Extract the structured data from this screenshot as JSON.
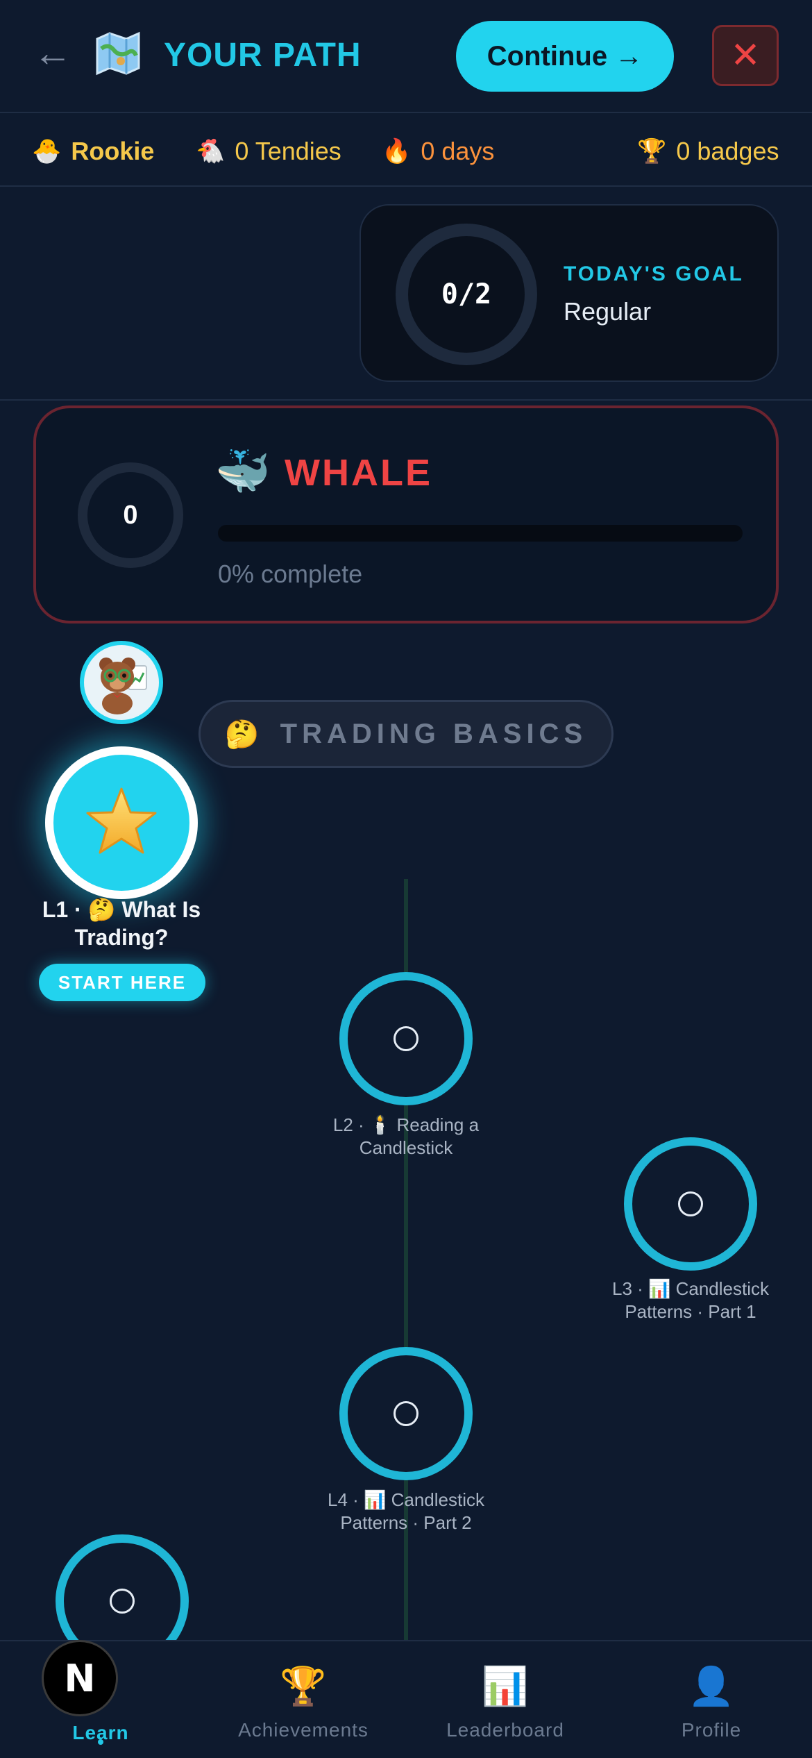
{
  "header": {
    "back_icon": "←",
    "map_icon": "map-icon",
    "title": "YOUR PATH",
    "continue_label": "Continue →",
    "close_icon": "✕"
  },
  "stats": {
    "rank_icon": "🐣",
    "rank": "Rookie",
    "tendies_icon": "🐔",
    "tendies": "0 Tendies",
    "streak_icon": "🔥",
    "streak": "0 days",
    "badges_icon": "🏆",
    "badges": "0 badges"
  },
  "goal": {
    "count": "0/2",
    "label": "TODAY'S GOAL",
    "mode": "Regular"
  },
  "level": {
    "number": "0",
    "icon": "🐳",
    "name": "WHALE",
    "progress": 0,
    "progress_text": "0% complete"
  },
  "section": {
    "emoji": "🤔",
    "title": "TRADING BASICS"
  },
  "lessons": [
    {
      "label": "L1 · 🤔  What Is Trading?",
      "icon": "⭐",
      "action": "START HERE"
    },
    {
      "label": "L2 · 🕯️  Reading a Candlestick"
    },
    {
      "label": "L3 · 📊  Candlestick Patterns · Part 1"
    },
    {
      "label": "L4 · 📊  Candlestick Patterns · Part 2"
    }
  ],
  "nav": {
    "learn": "Learn",
    "achievements_icon": "🏆",
    "achievements": "Achievements",
    "leaderboard_icon": "📊",
    "leaderboard": "Leaderboard",
    "profile_icon": "👤",
    "profile": "Profile",
    "logo": "N"
  },
  "colors": {
    "background": "#0e1a2e",
    "accent": "#22d3ee",
    "danger": "#ef4444",
    "gold": "#f5c84b"
  }
}
